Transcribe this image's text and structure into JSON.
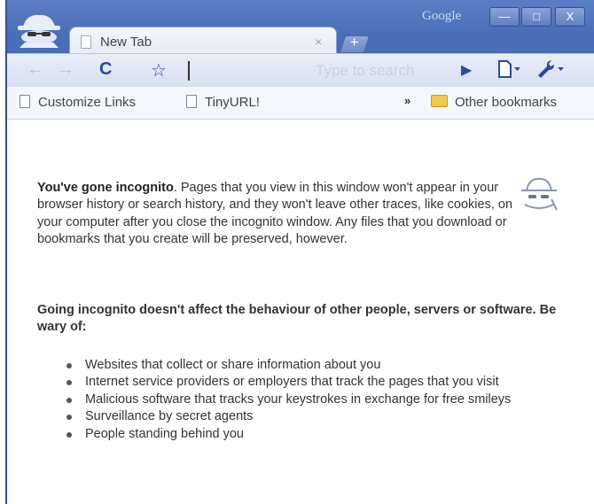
{
  "titlebar": {
    "brand": "Google",
    "minimize_glyph": "—",
    "maximize_glyph": "□",
    "close_glyph": "X"
  },
  "tab": {
    "title": "New Tab",
    "close_glyph": "×",
    "new_tab_glyph": "+"
  },
  "toolbar": {
    "back_glyph": "←",
    "forward_glyph": "→",
    "reload_glyph": "C",
    "star_glyph": "☆",
    "omnibox_placeholder": "Type to search",
    "go_glyph": "▶",
    "page_menu_glyph": "▾",
    "wrench_menu_glyph": "▾"
  },
  "bookmarks": {
    "items": [
      {
        "label": "Customize Links"
      },
      {
        "label": "TinyURL!"
      }
    ],
    "more_glyph": "»",
    "other_bookmarks": "Other bookmarks"
  },
  "content": {
    "intro_strong": "You've gone incognito",
    "intro_rest": ". Pages that you view in this window won't appear in your browser history or search history, and they won't leave other traces, like cookies, on your computer after you close the incognito window. Any files that you download or bookmarks that you create will be preserved, however.",
    "warning": "Going incognito doesn't affect the behaviour of other people, servers or software. Be wary of:",
    "bullets": [
      "Websites that collect or share information about you",
      "Internet service providers or employers that track the pages that you visit",
      "Malicious software that tracks your keystrokes in exchange for free smileys",
      "Surveillance by secret agents",
      "People standing behind you"
    ]
  },
  "colors": {
    "frame": "#4a6db7",
    "toolbar": "#dde6f4",
    "bookmarks_bar": "#f3f6fb",
    "icon_blue": "#2b4a9a"
  },
  "icons": [
    "incognito-icon",
    "page-icon",
    "close-icon",
    "new-tab-icon",
    "back-icon",
    "forward-icon",
    "reload-icon",
    "star-icon",
    "go-icon",
    "page-menu-icon",
    "wrench-icon",
    "folder-icon",
    "spy-icon"
  ]
}
